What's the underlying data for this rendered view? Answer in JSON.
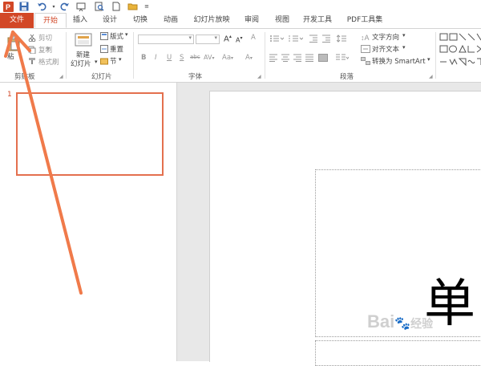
{
  "qat": {
    "icons": [
      "powerpoint-logo-icon",
      "save-icon",
      "undo-icon",
      "redo-icon",
      "slideshow-icon",
      "print-preview-icon",
      "new-file-icon",
      "open-folder-icon",
      "customize-qat-icon"
    ],
    "accent": "#d24726"
  },
  "tabs": [
    "文件",
    "开始",
    "插入",
    "设计",
    "切换",
    "动画",
    "幻灯片放映",
    "审阅",
    "视图",
    "开发工具",
    "PDF工具集"
  ],
  "clipboard": {
    "paste": "粘",
    "cut": "剪切",
    "copy": "复制",
    "format_painter": "格式刷",
    "group_label": "剪贴板"
  },
  "slides_group": {
    "new_slide_line1": "新建",
    "new_slide_line2": "幻灯片",
    "layout": "版式",
    "reset": "重置",
    "section": "节",
    "group_label": "幻灯片"
  },
  "font_group": {
    "font_name": "",
    "font_size": "",
    "bold": "B",
    "italic": "I",
    "underline": "U",
    "shadow": "S",
    "strike": "abc",
    "spacing": "AV",
    "case": "Aa",
    "color": "A",
    "grow": "A",
    "shrink": "A",
    "clear": "A",
    "group_label": "字体"
  },
  "paragraph_group": {
    "text_direction": "文字方向",
    "align_text": "对齐文本",
    "smartart": "转换为 SmartArt",
    "group_label": "段落"
  },
  "thumbnails": {
    "slide_number": "1"
  },
  "slide": {
    "title_char": "单"
  },
  "watermark": {
    "text": "Bai",
    "text2": "经验"
  }
}
